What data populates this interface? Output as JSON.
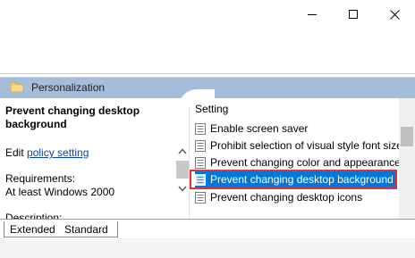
{
  "window": {
    "controls": [
      "minimize",
      "maximize",
      "close"
    ]
  },
  "header": {
    "title": "Personalization",
    "band_color": "#a3bddb"
  },
  "description": {
    "title": "Prevent changing desktop background",
    "edit_prefix": "Edit",
    "edit_link": "policy setting",
    "requirements_label": "Requirements:",
    "requirements_value": "At least Windows 2000",
    "description_label": "Description:"
  },
  "list": {
    "column_header": "Setting",
    "rows": [
      {
        "label": "Enable screen saver",
        "selected": false
      },
      {
        "label": "Prohibit selection of visual style font size",
        "selected": false
      },
      {
        "label": "Prevent changing color and appearance",
        "selected": false
      },
      {
        "label": "Prevent changing desktop background",
        "selected": true
      },
      {
        "label": "Prevent changing desktop icons",
        "selected": false
      }
    ],
    "selection_color": "#0078d7",
    "highlight_outline_color": "#e0323c"
  },
  "tabs": [
    {
      "label": "Extended",
      "active": true
    },
    {
      "label": "Standard",
      "active": false
    }
  ]
}
